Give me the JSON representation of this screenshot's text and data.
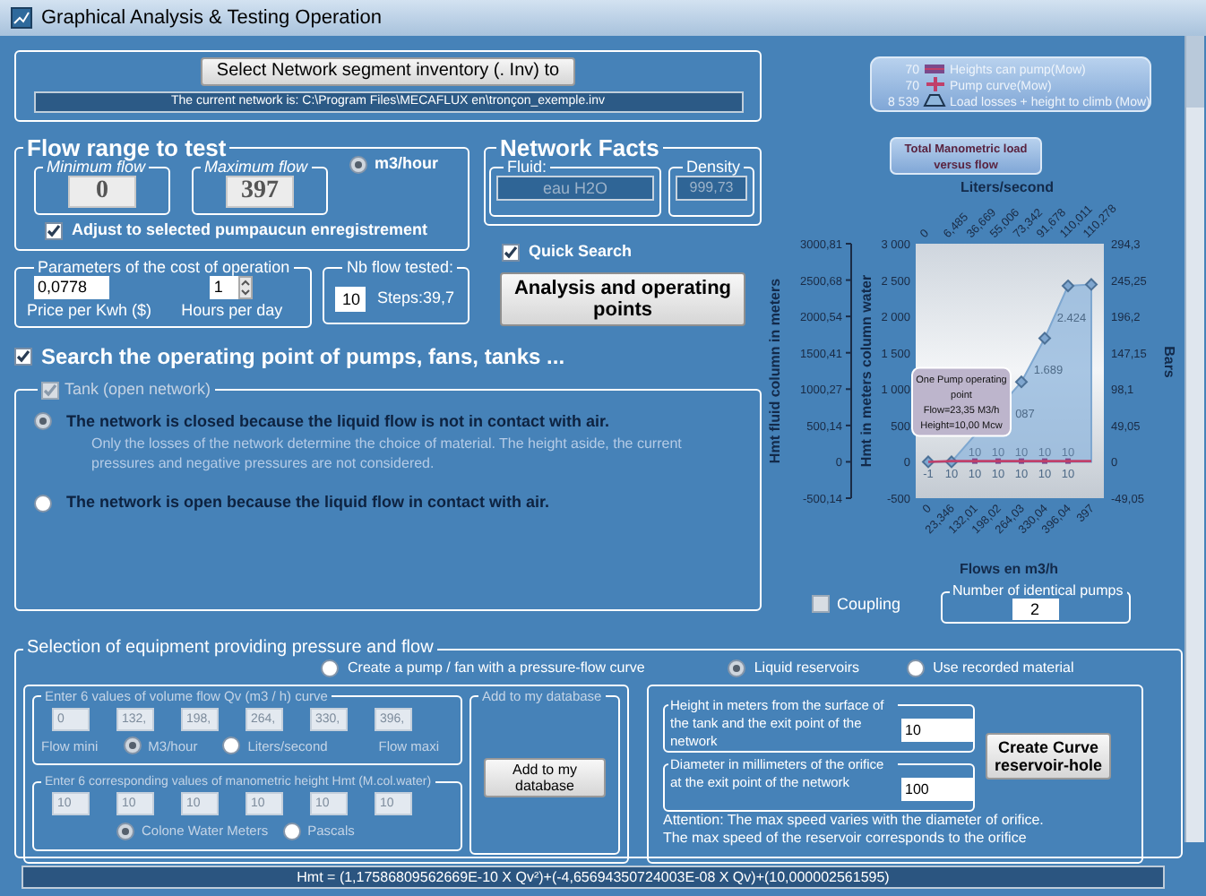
{
  "window": {
    "title": "Graphical Analysis & Testing Operation"
  },
  "network_select": {
    "button": "Select Network segment inventory (. Inv) to",
    "current_network": "The current network is: C:\\Program Files\\MECAFLUX en\\tronçon_exemple.inv"
  },
  "flow_range": {
    "title": "Flow range to test",
    "min": {
      "label": "Minimum flow",
      "value": "0"
    },
    "max": {
      "label": "Maximum flow",
      "value": "397"
    },
    "unit": {
      "label": "m3/hour",
      "selected": true
    },
    "adjust": {
      "label": "Adjust to selected pumpaucun enregistrement",
      "checked": true
    }
  },
  "network_facts": {
    "title": "Network Facts",
    "fluid": {
      "label": "Fluid:",
      "value": "eau H2O"
    },
    "density": {
      "label": "Density",
      "value": "999,73"
    }
  },
  "quick_search": {
    "label": "Quick Search",
    "checked": true
  },
  "analysis_button": "Analysis and operating points",
  "cost": {
    "title": "Parameters of the cost of operation",
    "price": {
      "value": "0,0778",
      "label": "Price per Kwh ($)"
    },
    "hours": {
      "value": "1",
      "label": "Hours per day"
    }
  },
  "nb_flow": {
    "title": "Nb flow tested:",
    "value": "10",
    "steps": "Steps:39,7"
  },
  "search_operating": {
    "label": "Search the operating point of pumps, fans, tanks ...",
    "checked": true
  },
  "tank": {
    "label": "Tank (open network)",
    "checked": true,
    "disabled": true,
    "options": [
      {
        "label": "The network is closed because the liquid flow is not in contact with air.",
        "selected": true,
        "note": "Only the losses of the network determine the choice of material. The height aside, the current pressures and negative pressures are not considered."
      },
      {
        "label": "The network is open because the liquid flow in contact with air.",
        "selected": false
      }
    ]
  },
  "chart": {
    "legend_values": [
      "70",
      "70",
      "8 539"
    ],
    "secondary_axes": {
      "top": {
        "label": "Liters/second",
        "ticks": [
          "0",
          "6,485",
          "36,669",
          "55,006",
          "73,342",
          "91,678",
          "110,011",
          "110,278"
        ]
      },
      "left": {
        "label": "Hmt fluid column in meters",
        "ticks": [
          "3000,81",
          "2500,68",
          "2000,54",
          "1500,41",
          "1000,27",
          "500,14",
          "0",
          "-500,14"
        ]
      },
      "right": {
        "label": "Bars",
        "ticks": [
          "294,3",
          "245,25",
          "196,2",
          "147,15",
          "98,1",
          "49,05",
          "0",
          "-49,05"
        ]
      }
    },
    "chart_data": {
      "type": "area",
      "title": "Total Manometric load versus flow",
      "xlabel": "Flows en m3/h",
      "ylabel": "Hmt in meters column water",
      "legend": "top",
      "categories": [
        "0",
        "23,346",
        "132,01",
        "198,02",
        "264,03",
        "330,04",
        "396,04",
        "397"
      ],
      "series": [
        {
          "name": "Heights can pump(Mow)",
          "color": "#7a4a8c",
          "type": "scatter",
          "marker": "square",
          "values": [
            null,
            null,
            10,
            10,
            10,
            10,
            10,
            null
          ],
          "value_labels": [
            null,
            null,
            "10",
            "10",
            "10",
            "10",
            "10",
            null
          ]
        },
        {
          "name": "Pump curve(Mow)",
          "color": "#c0406a",
          "type": "line",
          "values": [
            -1,
            10,
            10,
            10,
            10,
            10,
            10,
            10
          ],
          "value_labels": [
            "-1",
            "10",
            "10",
            "10",
            "10",
            "10",
            "10",
            null
          ]
        },
        {
          "name": "Load losses + height to climb (Mow)",
          "color": "#8fb6dc",
          "type": "area",
          "marker": "diamond",
          "values": [
            0,
            0,
            null,
            null,
            1100,
            1700,
            2420,
            2440
          ]
        }
      ],
      "ylim": [
        -500,
        3000
      ],
      "yticks": [
        {
          "value": 3000,
          "label": "3 000"
        },
        {
          "value": 2500,
          "label": "2 500"
        },
        {
          "value": 2000,
          "label": "2 000"
        },
        {
          "value": 1500,
          "label": "1 500"
        },
        {
          "value": 1000,
          "label": "1 000"
        },
        {
          "value": 500,
          "label": "500"
        },
        {
          "value": 0,
          "label": "0"
        },
        {
          "value": -500,
          "label": "-500"
        }
      ],
      "annotations": [
        {
          "text": "One Pump operating\npoint\nFlow=23,35 M3/h\nHeight=10,00 Mcw",
          "x": "23,346",
          "y": 10
        },
        {
          "text": "087",
          "x": "264,03",
          "y": 1100
        },
        {
          "text": "1.689",
          "x": "330,04",
          "y": 1700
        },
        {
          "text": "2.424",
          "x": "396,04",
          "y": 2420
        }
      ]
    },
    "coupling": {
      "label": "Coupling",
      "checked": false
    },
    "identical_pumps": {
      "label": "Number of identical pumps",
      "value": "2"
    }
  },
  "selection": {
    "title": "Selection of equipment providing pressure and flow",
    "sources": [
      {
        "label": "Create a pump / fan with a pressure-flow curve",
        "selected": false
      },
      {
        "label": "Liquid reservoirs",
        "selected": true
      },
      {
        "label": "Use recorded material",
        "selected": false
      }
    ],
    "pump_curve": {
      "disabled": true,
      "flows": {
        "title": "Enter 6 values of volume flow Qv (m3 / h) curve",
        "values": [
          "0",
          "132,",
          "198,",
          "264,",
          "330,",
          "396,"
        ],
        "min_label": "Flow mini",
        "max_label": "Flow maxi",
        "units": [
          {
            "label": "M3/hour",
            "selected": true
          },
          {
            "label": "Liters/second",
            "selected": false
          }
        ]
      },
      "heights": {
        "title": "Enter 6 corresponding values of manometric height Hmt (M.col.water)",
        "values": [
          "10",
          "10",
          "10",
          "10",
          "10",
          "10"
        ],
        "units": [
          {
            "label": "Colone Water Meters",
            "selected": true
          },
          {
            "label": "Pascals",
            "selected": false
          }
        ]
      },
      "database": {
        "title": "Add to my database",
        "button": "Add to my database"
      }
    },
    "reservoir": {
      "height": {
        "label": "Height in meters from the surface of the tank and the exit point of the network",
        "value": "10"
      },
      "diameter": {
        "label": "Diameter in millimeters of the orifice at the exit point of the network",
        "value": "100"
      },
      "button": "Create Curve reservoir-hole",
      "attention": [
        "Attention: The max speed varies with the diameter of orifice.",
        "The max speed of the reservoir corresponds to the orifice"
      ]
    }
  },
  "formula": "Hmt = (1,17586809562669E-10 X Qv²)+(-4,65694350724003E-08 X Qv)+(10,000002561595)"
}
